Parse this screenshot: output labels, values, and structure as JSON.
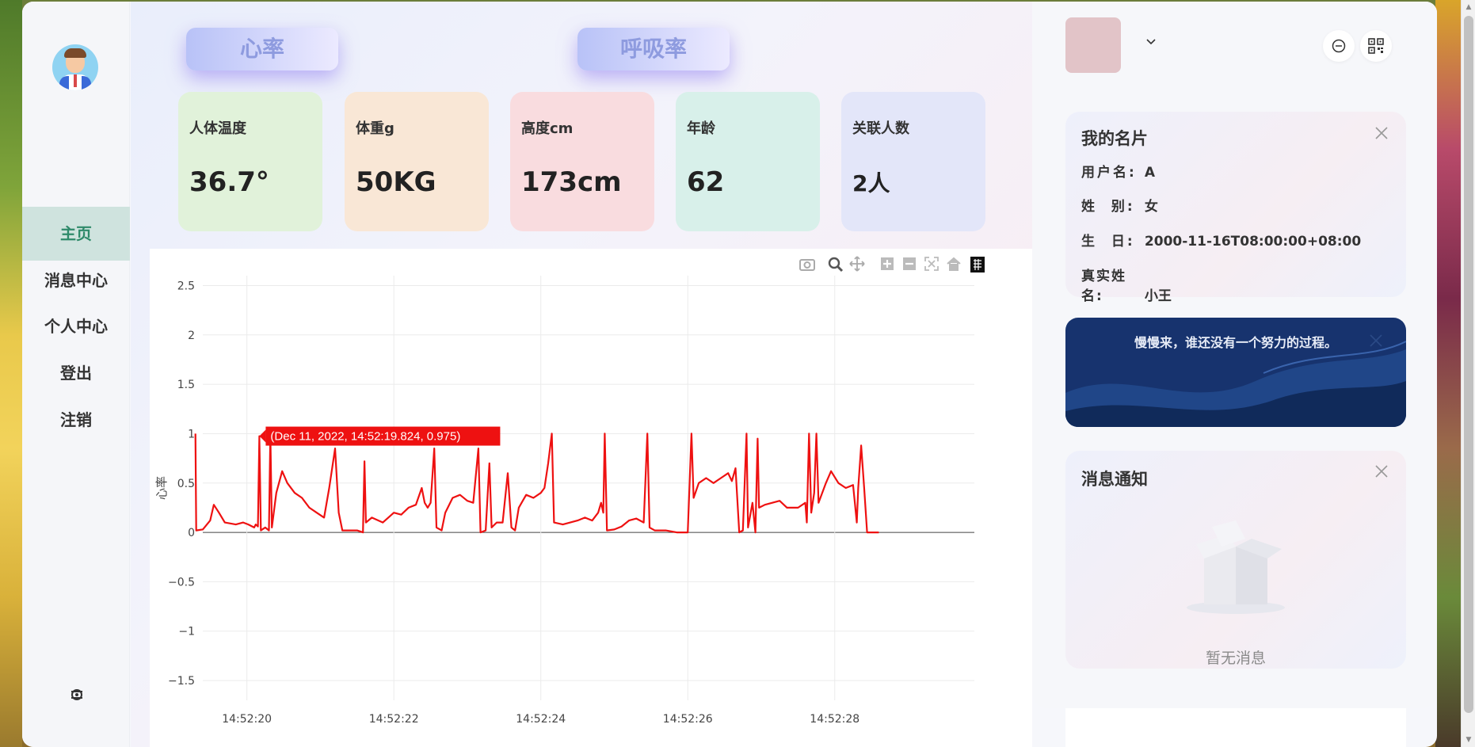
{
  "sidebar": {
    "items": [
      {
        "label": "主页"
      },
      {
        "label": "消息中心"
      },
      {
        "label": "个人中心"
      },
      {
        "label": "登出"
      },
      {
        "label": "注销"
      }
    ],
    "settings_icon": "settings-icon"
  },
  "tabs": [
    {
      "label": "心率"
    },
    {
      "label": "呼吸率"
    }
  ],
  "stats": [
    {
      "label": "人体温度",
      "value": "36.7°",
      "color": "#e1f2da"
    },
    {
      "label": "体重g",
      "value": "50KG",
      "color": "#f9e7d6"
    },
    {
      "label": "高度cm",
      "value": "173cm",
      "color": "#f9dcdf"
    },
    {
      "label": "年龄",
      "value": "62",
      "color": "#d8f0ea"
    },
    {
      "label": "关联人数",
      "value": "2人",
      "color": "#e3e6f9"
    }
  ],
  "chart_toolbar": [
    "camera-icon",
    "zoom-icon",
    "pan-icon",
    "zoom-in-icon",
    "zoom-out-icon",
    "autoscale-icon",
    "reset-axes-icon",
    "plotly-logo-icon"
  ],
  "chart_data": {
    "type": "line",
    "ylabel": "心率",
    "ylim": [
      -1.7,
      2.6
    ],
    "xrange": [
      "14:52:19.4",
      "14:52:29.9"
    ],
    "x_ticks": [
      "14:52:20",
      "14:52:22",
      "14:52:24",
      "14:52:26",
      "14:52:28"
    ],
    "y_ticks": [
      "2.5",
      "2",
      "1.5",
      "1",
      "0.5",
      "0",
      "−0.5",
      "−1",
      "−1.5"
    ],
    "y_tick_values": [
      2.5,
      2,
      1.5,
      1,
      0.5,
      0,
      -0.5,
      -1,
      -1.5
    ],
    "grid": true,
    "tooltip": "(Dec 11, 2022, 14:52:19.824, 0.975)",
    "series": [
      {
        "color": "#ee1111",
        "points": [
          [
            19.3,
            1.0
          ],
          [
            19.31,
            0.02
          ],
          [
            19.4,
            0.03
          ],
          [
            19.5,
            0.12
          ],
          [
            19.55,
            0.28
          ],
          [
            19.62,
            0.2
          ],
          [
            19.7,
            0.1
          ],
          [
            19.85,
            0.08
          ],
          [
            19.95,
            0.1
          ],
          [
            20.02,
            0.08
          ],
          [
            20.1,
            0.05
          ],
          [
            20.12,
            0.08
          ],
          [
            20.15,
            0.06
          ],
          [
            20.17,
            0.975
          ],
          [
            20.19,
            0.02
          ],
          [
            20.25,
            0.05
          ],
          [
            20.3,
            0.02
          ],
          [
            20.32,
            1.0
          ],
          [
            20.34,
            0.05
          ],
          [
            20.4,
            0.4
          ],
          [
            20.48,
            0.62
          ],
          [
            20.55,
            0.5
          ],
          [
            20.65,
            0.4
          ],
          [
            20.75,
            0.35
          ],
          [
            20.85,
            0.25
          ],
          [
            20.95,
            0.2
          ],
          [
            21.05,
            0.15
          ],
          [
            21.12,
            0.45
          ],
          [
            21.2,
            0.85
          ],
          [
            21.25,
            0.2
          ],
          [
            21.3,
            0.02
          ],
          [
            21.5,
            0.02
          ],
          [
            21.58,
            0.0
          ],
          [
            21.6,
            0.72
          ],
          [
            21.62,
            0.1
          ],
          [
            21.7,
            0.15
          ],
          [
            21.85,
            0.1
          ],
          [
            22.0,
            0.2
          ],
          [
            22.1,
            0.18
          ],
          [
            22.2,
            0.25
          ],
          [
            22.3,
            0.28
          ],
          [
            22.38,
            0.45
          ],
          [
            22.42,
            0.3
          ],
          [
            22.46,
            0.25
          ],
          [
            22.5,
            0.3
          ],
          [
            22.55,
            0.85
          ],
          [
            22.58,
            0.05
          ],
          [
            22.65,
            0.02
          ],
          [
            22.7,
            0.2
          ],
          [
            22.8,
            0.35
          ],
          [
            22.9,
            0.38
          ],
          [
            23.0,
            0.32
          ],
          [
            23.08,
            0.3
          ],
          [
            23.15,
            0.85
          ],
          [
            23.18,
            0.0
          ],
          [
            23.25,
            0.02
          ],
          [
            23.3,
            0.7
          ],
          [
            23.33,
            0.05
          ],
          [
            23.4,
            0.1
          ],
          [
            23.48,
            0.1
          ],
          [
            23.55,
            0.6
          ],
          [
            23.6,
            0.05
          ],
          [
            23.65,
            0.02
          ],
          [
            23.7,
            0.25
          ],
          [
            23.8,
            0.38
          ],
          [
            23.9,
            0.35
          ],
          [
            24.0,
            0.4
          ],
          [
            24.05,
            0.45
          ],
          [
            24.1,
            0.7
          ],
          [
            24.15,
            1.0
          ],
          [
            24.18,
            0.1
          ],
          [
            24.3,
            0.08
          ],
          [
            24.4,
            0.1
          ],
          [
            24.5,
            0.12
          ],
          [
            24.6,
            0.15
          ],
          [
            24.7,
            0.12
          ],
          [
            24.78,
            0.2
          ],
          [
            24.82,
            0.3
          ],
          [
            24.85,
            0.2
          ],
          [
            24.87,
            1.0
          ],
          [
            24.9,
            0.02
          ],
          [
            25.0,
            0.03
          ],
          [
            25.1,
            0.06
          ],
          [
            25.2,
            0.12
          ],
          [
            25.3,
            0.14
          ],
          [
            25.4,
            0.1
          ],
          [
            25.45,
            1.0
          ],
          [
            25.48,
            0.05
          ],
          [
            25.55,
            0.02
          ],
          [
            25.7,
            0.02
          ],
          [
            25.85,
            0.0
          ],
          [
            26.0,
            0.0
          ],
          [
            26.05,
            1.0
          ],
          [
            26.08,
            0.35
          ],
          [
            26.15,
            0.5
          ],
          [
            26.25,
            0.55
          ],
          [
            26.35,
            0.5
          ],
          [
            26.45,
            0.55
          ],
          [
            26.55,
            0.6
          ],
          [
            26.6,
            0.52
          ],
          [
            26.65,
            0.65
          ],
          [
            26.7,
            0.0
          ],
          [
            26.75,
            0.02
          ],
          [
            26.8,
            1.0
          ],
          [
            26.82,
            0.05
          ],
          [
            26.88,
            0.3
          ],
          [
            26.92,
            0.0
          ],
          [
            26.95,
            0.95
          ],
          [
            26.97,
            0.25
          ],
          [
            27.05,
            0.28
          ],
          [
            27.15,
            0.3
          ],
          [
            27.25,
            0.32
          ],
          [
            27.35,
            0.25
          ],
          [
            27.5,
            0.25
          ],
          [
            27.6,
            0.3
          ],
          [
            27.62,
            0.1
          ],
          [
            27.65,
            1.0
          ],
          [
            27.68,
            0.2
          ],
          [
            27.72,
            0.4
          ],
          [
            27.75,
            1.0
          ],
          [
            27.78,
            0.3
          ],
          [
            27.88,
            0.5
          ],
          [
            27.95,
            0.62
          ],
          [
            28.05,
            0.5
          ],
          [
            28.15,
            0.45
          ],
          [
            28.25,
            0.48
          ],
          [
            28.3,
            0.1
          ],
          [
            28.32,
            0.45
          ],
          [
            28.36,
            0.88
          ],
          [
            28.4,
            0.45
          ],
          [
            28.44,
            0.0
          ],
          [
            28.6,
            0.0
          ]
        ]
      }
    ]
  },
  "topbar": {
    "chevron_icon": "chevron-down-icon",
    "minus_icon": "minus-circle-icon",
    "qr_icon": "qr-code-icon"
  },
  "card": {
    "title": "我的名片",
    "fields": [
      {
        "key": "用户名:",
        "value": "A"
      },
      {
        "key": "姓  别:",
        "value": "女"
      },
      {
        "key": "生  日:",
        "value": "2000-11-16T08:00:00+08:00"
      },
      {
        "key": "真实姓名:",
        "value": "小王"
      }
    ]
  },
  "banner": {
    "text": "慢慢来，谁还没有一个努力的过程。"
  },
  "notice": {
    "title": "消息通知",
    "empty": "暂无消息"
  },
  "colors": {
    "accent_nav": "#2f8a6a",
    "active_nav_bg": "#cfe3de",
    "tab_text": "#8e9bdf",
    "line": "#ee1111"
  }
}
